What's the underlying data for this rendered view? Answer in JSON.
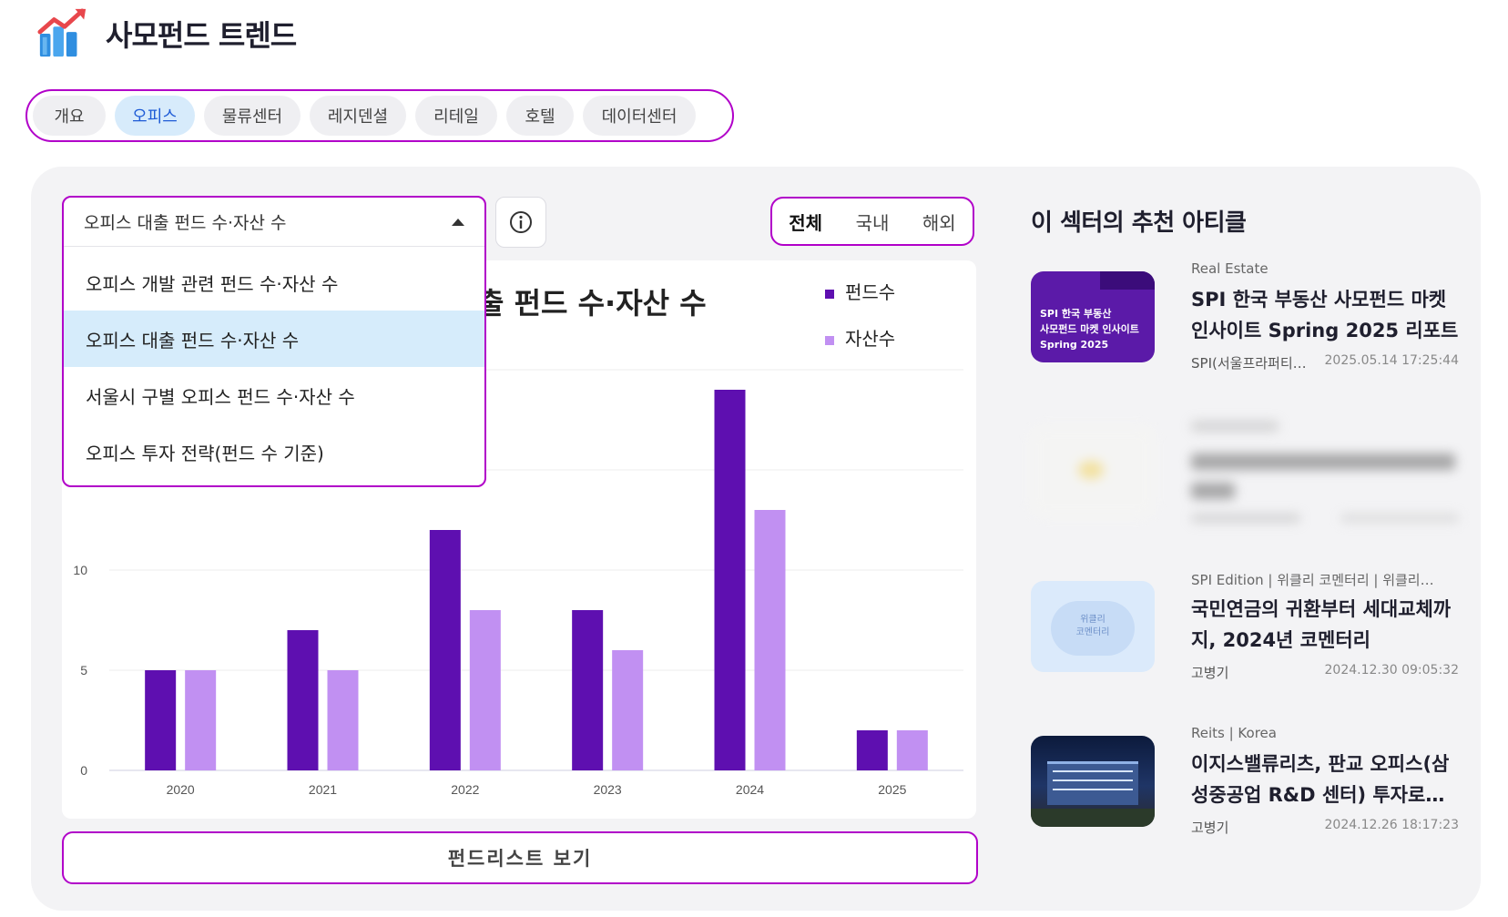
{
  "header": {
    "title": "사모펀드 트렌드"
  },
  "tabs": [
    {
      "label": "개요",
      "active": false
    },
    {
      "label": "오피스",
      "active": true
    },
    {
      "label": "물류센터",
      "active": false
    },
    {
      "label": "레지덴셜",
      "active": false
    },
    {
      "label": "리테일",
      "active": false
    },
    {
      "label": "호텔",
      "active": false
    },
    {
      "label": "데이터센터",
      "active": false
    }
  ],
  "dropdown": {
    "selected": "오피스 대출 펀드 수·자산 수",
    "options": [
      "오피스 개발 관련 펀드 수·자산 수",
      "오피스 대출 펀드 수·자산 수",
      "서울시 구별 오피스 펀드 수·자산 수",
      "오피스 투자 전략(펀드 수 기준)"
    ]
  },
  "region": {
    "options": [
      "전체",
      "국내",
      "해외"
    ],
    "active": "전체"
  },
  "chart_data": {
    "type": "bar",
    "title": "출 펀드 수·자산 수",
    "categories": [
      "2020",
      "2021",
      "2022",
      "2023",
      "2024",
      "2025"
    ],
    "series": [
      {
        "name": "펀드수",
        "color": "#5e0fb0",
        "values": [
          5,
          7,
          12,
          8,
          19,
          2
        ]
      },
      {
        "name": "자산수",
        "color": "#c190f2",
        "values": [
          5,
          5,
          8,
          6,
          13,
          2
        ]
      }
    ],
    "yticks": [
      "0",
      "5",
      "10"
    ],
    "ylim": [
      0,
      20
    ],
    "legend": "top-right",
    "grid": true
  },
  "fund_list_button": "펀드리스트 보기",
  "articles": {
    "section_title": "이 섹터의 추천 아티클",
    "items": [
      {
        "category": "Real Estate",
        "title": "SPI 한국 부동산 사모펀드 마켓 인사이트 Spring 2025 리포트",
        "author": "SPI(서울프라퍼티…",
        "date": "2025.05.14 17:25:44",
        "thumb_text": [
          "SPI 한국 부동산",
          "사모펀드 마켓 인사이트",
          "Spring 2025"
        ],
        "blurred": false
      },
      {
        "category": "",
        "title": "",
        "author": "",
        "date": "",
        "thumb_text": [],
        "blurred": true
      },
      {
        "category": "SPI Edition | 위클리 코멘터리 | 위클리…",
        "title": "국민연금의 귀환부터 세대교체까지, 2024년 코멘터리",
        "author": "고병기",
        "date": "2024.12.30 09:05:32",
        "thumb_text": [
          "위클리",
          "코멘터리"
        ],
        "blurred": false
      },
      {
        "category": "Reits | Korea",
        "title": "이지스밸류리츠, 판교 오피스(삼성중공업 R&D 센터) 투자로…",
        "author": "고병기",
        "date": "2024.12.26 18:17:23",
        "thumb_text": [],
        "blurred": false
      }
    ]
  }
}
